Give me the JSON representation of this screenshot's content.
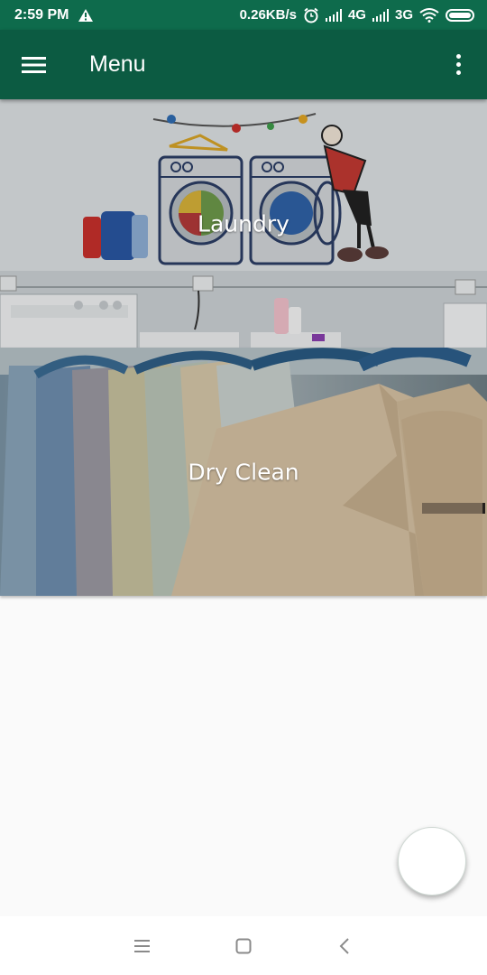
{
  "status_bar": {
    "time": "2:59 PM",
    "speed": "0.26KB/s",
    "net1": "4G",
    "net2": "3G"
  },
  "app_bar": {
    "title": "Menu"
  },
  "cards": [
    {
      "label": "Laundry"
    },
    {
      "label": "Dry Clean"
    }
  ],
  "colors": {
    "status_bar": "#0e6b4c",
    "app_bar": "#0c5b42",
    "background": "#fafafa"
  }
}
